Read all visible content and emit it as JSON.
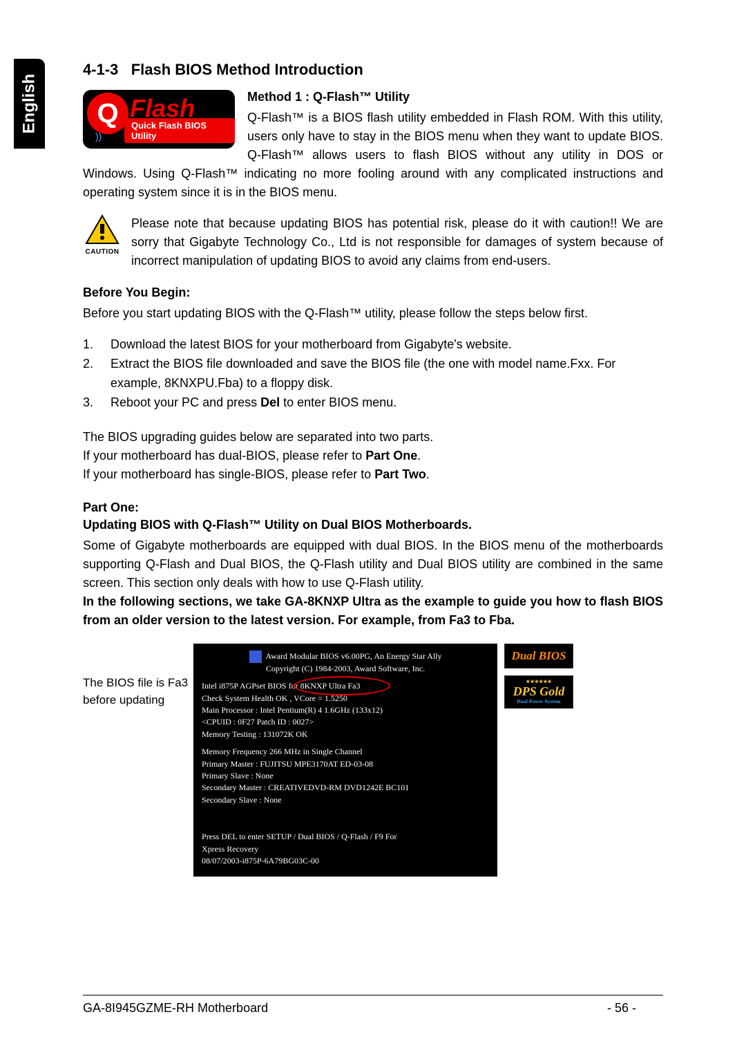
{
  "sideTab": "English",
  "sectionNumber": "4-1-3",
  "sectionTitle": "Flash BIOS Method Introduction",
  "qflashLogo": {
    "q": "Q",
    "flash": "Flash",
    "subtitle": "Quick Flash BIOS Utility"
  },
  "method1": {
    "title": "Method 1 : Q-Flash™ Utility",
    "para": "Q-Flash™ is a BIOS flash utility embedded in Flash ROM. With this utility, users only have to stay in the BIOS menu when they want to update BIOS. Q-Flash™ allows users to flash BIOS without any utility in DOS or Windows. Using Q-Flash™ indicating no more fooling around with any complicated instructions and operating system since it is in the BIOS menu."
  },
  "caution": {
    "label": "CAUTION",
    "text": "Please note that because updating BIOS has potential risk, please do it with caution!! We are sorry that Gigabyte Technology Co., Ltd is not responsible for damages of system because of incorrect manipulation of updating BIOS to avoid any claims from end-users."
  },
  "beforeBegin": {
    "heading": "Before You Begin:",
    "intro": "Before you start updating BIOS with the Q-Flash™ utility, please follow the steps below first.",
    "steps": [
      "Download the latest BIOS for your motherboard from Gigabyte's website.",
      "Extract the BIOS file downloaded and save the BIOS file (the one with model name.Fxx. For example, 8KNXPU.Fba) to a floppy disk.",
      "Reboot your PC and press Del to enter BIOS menu."
    ],
    "guideIntro": "The BIOS upgrading guides below are separated into two parts.",
    "dualLine": "If your motherboard has dual-BIOS, please refer to ",
    "dualBold": "Part One",
    "singleLine": "If your motherboard has single-BIOS, please refer to ",
    "singleBold": "Part Two"
  },
  "partOne": {
    "heading": "Part One:",
    "subheading": "Updating BIOS with Q-Flash™ Utility on Dual BIOS Motherboards.",
    "para": "Some of Gigabyte motherboards are equipped with dual BIOS. In the BIOS menu of the motherboards supporting Q-Flash and Dual BIOS, the Q-Flash utility and Dual BIOS utility are combined in the same screen. This section only deals with how to use Q-Flash utility.",
    "bold": "In the following sections, we take GA-8KNXP Ultra as the example to guide you how to flash BIOS from an older version to the latest version. For example, from Fa3 to Fba."
  },
  "biosCaption": "The BIOS file is Fa3 before updating",
  "biosScreen": {
    "line1": "Award Modular BIOS v6.00PG, An Energy Star Ally",
    "line2": "Copyright  (C) 1984-2003, Award Software,  Inc.",
    "line3a": "Intel i875P AGPset BIOS for ",
    "line3b": "8KNXP Ultra Fa3",
    "line4": "Check System Health OK , VCore = 1.5250",
    "line5": "Main Processor :  Intel Pentium(R) 4  1.6GHz  (133x12)",
    "line6": "<CPUID : 0F27 Patch ID  : 0027>",
    "line7": "Memory Testing   : 131072K OK",
    "line8": "Memory Frequency 266 MHz in Single Channel",
    "line9": "Primary Master : FUJITSU MPE3170AT ED-03-08",
    "line10": "Primary Slave : None",
    "line11": "Secondary Master :  CREATIVEDVD-RM DVD1242E BC101",
    "line12": "Secondary Slave : None",
    "line13": "Press DEL to enter SETUP / Dual BIOS / Q-Flash / F9 For",
    "line14": "Xpress Recovery",
    "line15": "08/07/2003-i875P-6A79BG03C-00"
  },
  "logos": {
    "dualBios": "Dual BIOS",
    "dpsMain": "DPS Gold",
    "dpsSub": "Dual Power System"
  },
  "footer": {
    "model": "GA-8I945GZME-RH Motherboard",
    "page": "- 56 -"
  }
}
